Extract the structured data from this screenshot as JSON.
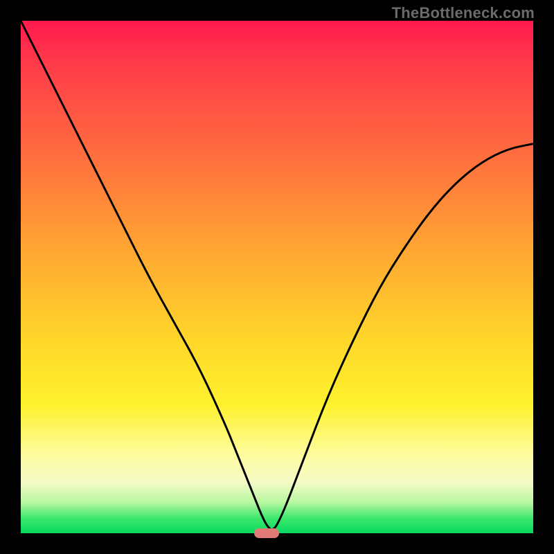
{
  "watermark": "TheBottleneck.com",
  "colors": {
    "curve": "#000000",
    "marker": "#e27b78",
    "frame": "#000000"
  },
  "chart_data": {
    "type": "line",
    "title": "",
    "xlabel": "",
    "ylabel": "",
    "xlim": [
      0,
      100
    ],
    "ylim": [
      0,
      100
    ],
    "series": [
      {
        "name": "bottleneck-curve",
        "x": [
          0,
          5,
          10,
          15,
          20,
          25,
          30,
          35,
          40,
          42,
          44,
          46,
          47,
          48,
          49,
          50,
          52,
          55,
          60,
          65,
          70,
          75,
          80,
          85,
          90,
          95,
          100
        ],
        "y": [
          100,
          90,
          80,
          70,
          60,
          50,
          41,
          32,
          21,
          16,
          11,
          6,
          3.5,
          1.5,
          0.5,
          1.5,
          6,
          14,
          27,
          38,
          48,
          56,
          63,
          68.5,
          72.5,
          75,
          76
        ]
      }
    ],
    "marker": {
      "x": 48,
      "y": 0
    },
    "gradient_stops": [
      {
        "pos": 0,
        "color": "#ff1a4d"
      },
      {
        "pos": 25,
        "color": "#ff6a3f"
      },
      {
        "pos": 62,
        "color": "#ffd62a"
      },
      {
        "pos": 85,
        "color": "#fdfca1"
      },
      {
        "pos": 100,
        "color": "#07d85f"
      }
    ]
  }
}
